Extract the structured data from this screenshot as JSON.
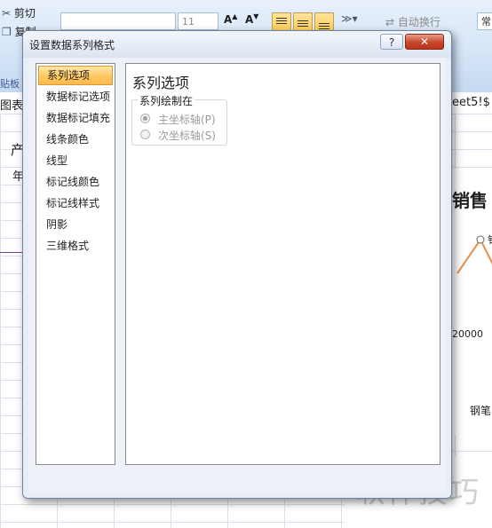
{
  "excel": {
    "ribbon": {
      "cut_label": "剪切",
      "copy_label": "复制",
      "clipboard_label": "贴板",
      "font_size": "11",
      "wrap_text_label": "自动换行",
      "number_format_label": "常"
    },
    "formula_bar": {
      "name_box_fragment": "图表",
      "formula_fragment": "eet5!$"
    },
    "cells": {
      "header_fragment": "产",
      "row_fragment": "年",
      "chart_title_fragment": "销售",
      "axis_value_fragment": "20000",
      "category_fragment": "钢笔",
      "marker_label_fragment": "钅"
    },
    "colors": {
      "series_line": "#e8914a",
      "purple_line": "#7a3e9d"
    }
  },
  "watermark": "软件技巧",
  "dialog": {
    "title": "设置数据系列格式",
    "help_label": "?",
    "close_label": "✕",
    "nav_items": [
      {
        "label": "系列选项",
        "selected": true
      },
      {
        "label": "数据标记选项",
        "selected": false
      },
      {
        "label": "数据标记填充",
        "selected": false
      },
      {
        "label": "线条颜色",
        "selected": false
      },
      {
        "label": "线型",
        "selected": false
      },
      {
        "label": "标记线颜色",
        "selected": false
      },
      {
        "label": "标记线样式",
        "selected": false
      },
      {
        "label": "阴影",
        "selected": false
      },
      {
        "label": "三维格式",
        "selected": false
      }
    ],
    "panel": {
      "title": "系列选项",
      "group_label": "系列绘制在",
      "options": [
        {
          "label": "主坐标轴(P)",
          "checked": true,
          "enabled": false
        },
        {
          "label": "次坐标轴(S)",
          "checked": false,
          "enabled": false
        }
      ]
    }
  }
}
